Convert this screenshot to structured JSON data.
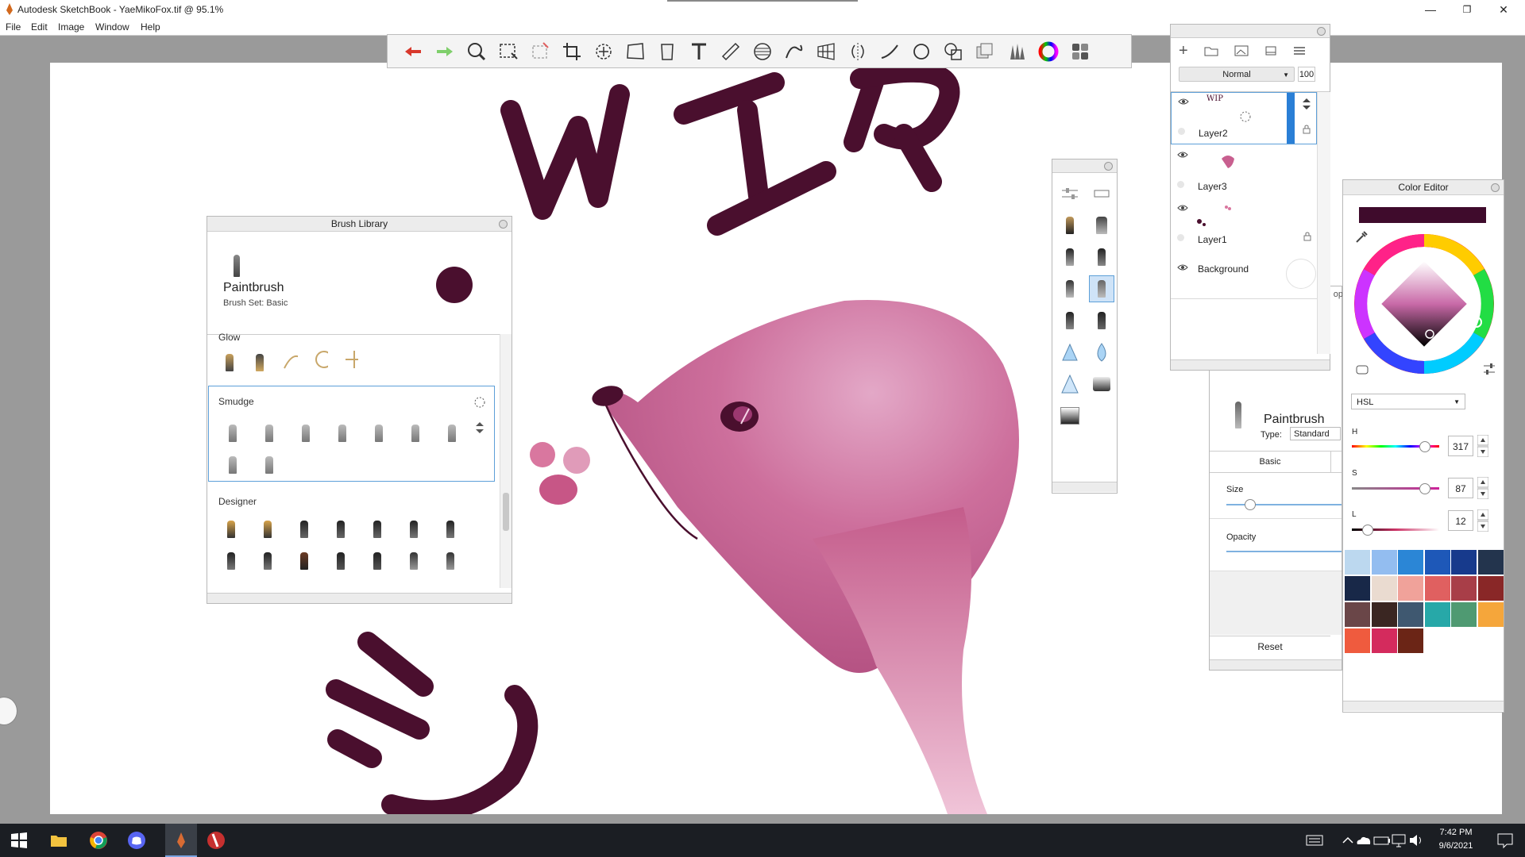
{
  "window": {
    "title": "Autodesk SketchBook - YaeMikoFox.tif @ 95.1%",
    "minimize": "—",
    "maximize": "❐",
    "close": "✕"
  },
  "menu": [
    "File",
    "Edit",
    "Image",
    "Window",
    "Help"
  ],
  "canvas": {
    "text_wip": "WIP"
  },
  "brush_library": {
    "title": "Brush Library",
    "brush_name": "Paintbrush",
    "brush_set": "Brush Set: Basic",
    "brush_color": "#4a0f2e",
    "sections": [
      {
        "title": "Glow",
        "count": 5
      },
      {
        "title": "Smudge",
        "count": 9
      },
      {
        "title": "Designer",
        "count": 14
      }
    ]
  },
  "layers": {
    "blend_mode": "Normal",
    "opacity": "100",
    "items": [
      {
        "name": "Layer2",
        "thumb_text": "WIP"
      },
      {
        "name": "Layer3"
      },
      {
        "name": "Layer1"
      },
      {
        "name": "Background"
      }
    ]
  },
  "brush_props": {
    "name": "Paintbrush",
    "type_label": "Type:",
    "type_value": "Standard",
    "tab": "Basic",
    "size_label": "Size",
    "opacity_label": "Opacity",
    "reset": "Reset",
    "partial_tab": "op"
  },
  "color_editor": {
    "title": "Color Editor",
    "current_color": "#3f0b2c",
    "mode": "HSL",
    "h_label": "H",
    "h": "317",
    "s_label": "S",
    "s": "87",
    "l_label": "L",
    "l": "12",
    "swatches": [
      "#bcd8ef",
      "#93bdf0",
      "#2b86d6",
      "#1e58b8",
      "#173a8c",
      "#23344d",
      "#182848",
      "#eadbd0",
      "#f0a29a",
      "#e06060",
      "#a83e48",
      "#892727",
      "#6a4648",
      "#3a2622",
      "#3f5870",
      "#27a8a8",
      "#4f9a72",
      "#f5a63b",
      "#ef5b3e",
      "#d42b5d",
      "#6b2516"
    ]
  },
  "taskbar": {
    "time": "7:42 PM",
    "date": "9/6/2021"
  }
}
